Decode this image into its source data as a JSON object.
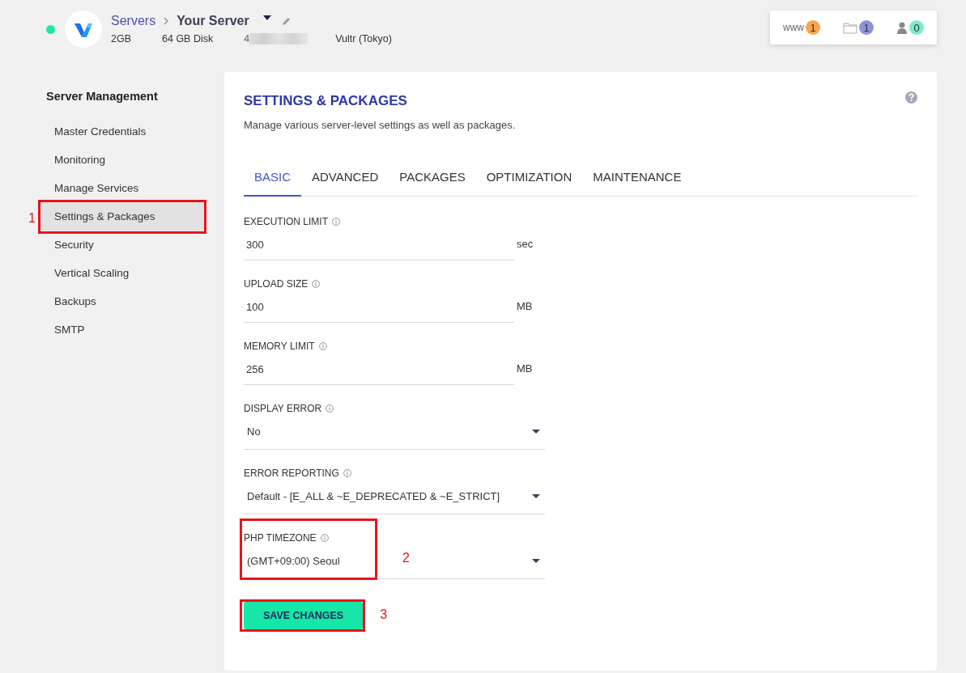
{
  "header": {
    "breadcrumb": {
      "parent": "Servers",
      "current": "Your Server"
    },
    "specs": [
      "2GB",
      "64 GB Disk"
    ],
    "ip_partial": "4",
    "location": "Vultr (Tokyo)"
  },
  "counters": [
    {
      "kind": "www",
      "label": "www",
      "count": "1",
      "color": "#f9a54f"
    },
    {
      "kind": "folder",
      "count": "1",
      "color": "#8e91dc"
    },
    {
      "kind": "user",
      "count": "0",
      "color": "#7ee9cb"
    }
  ],
  "sidebar": {
    "heading": "Server Management",
    "items": [
      {
        "label": "Master Credentials",
        "selected": false
      },
      {
        "label": "Monitoring",
        "selected": false
      },
      {
        "label": "Manage Services",
        "selected": false
      },
      {
        "label": "Settings & Packages",
        "selected": true,
        "annotation": "1"
      },
      {
        "label": "Security",
        "selected": false
      },
      {
        "label": "Vertical Scaling",
        "selected": false
      },
      {
        "label": "Backups",
        "selected": false
      },
      {
        "label": "SMTP",
        "selected": false
      }
    ]
  },
  "panel": {
    "title": "SETTINGS & PACKAGES",
    "subtitle": "Manage various server-level settings as well as packages.",
    "tabs": [
      {
        "label": "BASIC",
        "selected": true
      },
      {
        "label": "ADVANCED",
        "selected": false
      },
      {
        "label": "PACKAGES",
        "selected": false
      },
      {
        "label": "OPTIMIZATION",
        "selected": false
      },
      {
        "label": "MAINTENANCE",
        "selected": false
      }
    ],
    "fields": [
      {
        "kind": "input",
        "label": "EXECUTION LIMIT",
        "value": "300",
        "unit": "sec"
      },
      {
        "kind": "input",
        "label": "UPLOAD SIZE",
        "value": "100",
        "unit": "MB"
      },
      {
        "kind": "input",
        "label": "MEMORY LIMIT",
        "value": "256",
        "unit": "MB"
      },
      {
        "kind": "select",
        "label": "DISPLAY ERROR",
        "value": "No"
      },
      {
        "kind": "select",
        "label": "ERROR REPORTING",
        "value": "Default - [E_ALL & ~E_DEPRECATED & ~E_STRICT]"
      },
      {
        "kind": "select",
        "label": "PHP TIMEZONE",
        "value": "(GMT+09:00) Seoul",
        "annotation": "2"
      }
    ],
    "save_button": {
      "label": "SAVE CHANGES",
      "annotation": "3"
    }
  }
}
